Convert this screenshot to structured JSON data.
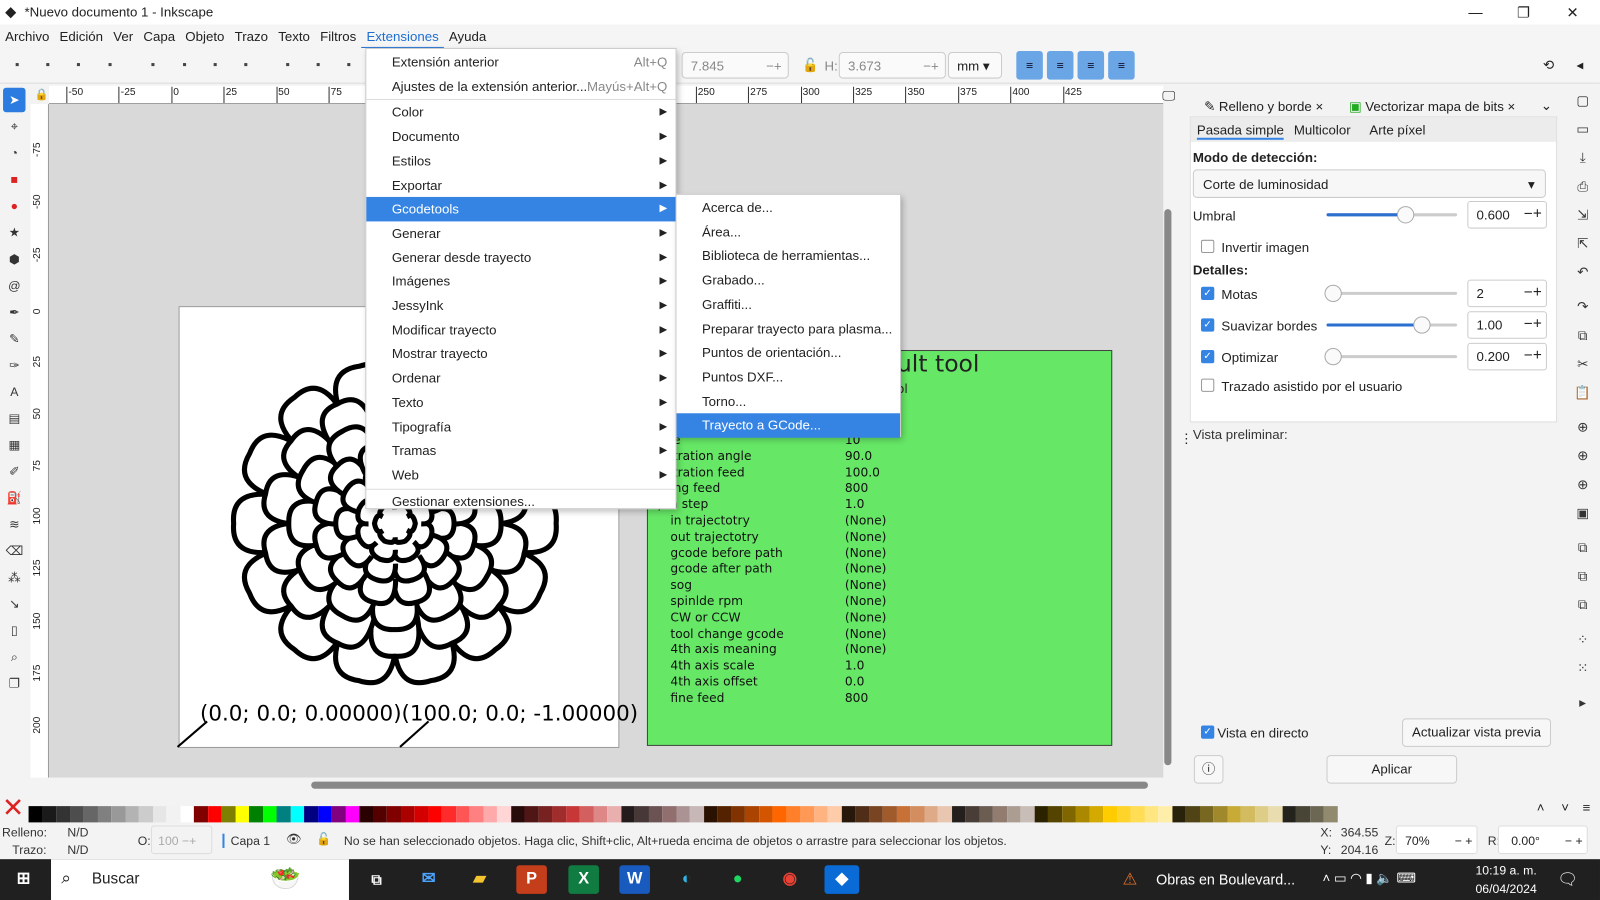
{
  "window": {
    "title": "*Nuevo documento 1 - Inkscape",
    "minimize": "—",
    "maximize": "❐",
    "close": "✕"
  },
  "menubar": [
    "Archivo",
    "Edición",
    "Ver",
    "Capa",
    "Objeto",
    "Trazo",
    "Texto",
    "Filtros",
    "Extensiones",
    "Ayuda"
  ],
  "toolbar": {
    "w_value": "7.845",
    "h_label": "H:",
    "h_value": "3.673",
    "unit": "mm"
  },
  "ruler_top": [
    "-50",
    "-25",
    "0",
    "25",
    "50",
    "75",
    "100",
    "125",
    "150",
    "175",
    "200",
    "225",
    "250",
    "275",
    "300",
    "325",
    "350",
    "375",
    "400",
    "425"
  ],
  "ruler_left": [
    "-75",
    "-50",
    "-25",
    "0",
    "25",
    "50",
    "75",
    "100",
    "125",
    "150",
    "175",
    "200"
  ],
  "extensions_menu": {
    "items": [
      {
        "label": "Extensión anterior",
        "shortcut": "Alt+Q"
      },
      {
        "label": "Ajustes de la extensión anterior...",
        "shortcut": "Mayús+Alt+Q"
      },
      {
        "label": "Color",
        "sub": true
      },
      {
        "label": "Documento",
        "sub": true
      },
      {
        "label": "Estilos",
        "sub": true
      },
      {
        "label": "Exportar",
        "sub": true
      },
      {
        "label": "Gcodetools",
        "sub": true,
        "highlight": true
      },
      {
        "label": "Generar",
        "sub": true
      },
      {
        "label": "Generar desde trayecto",
        "sub": true
      },
      {
        "label": "Imágenes",
        "sub": true
      },
      {
        "label": "JessyInk",
        "sub": true
      },
      {
        "label": "Modificar trayecto",
        "sub": true
      },
      {
        "label": "Mostrar trayecto",
        "sub": true
      },
      {
        "label": "Ordenar",
        "sub": true
      },
      {
        "label": "Texto",
        "sub": true
      },
      {
        "label": "Tipografía",
        "sub": true
      },
      {
        "label": "Tramas",
        "sub": true
      },
      {
        "label": "Web",
        "sub": true
      },
      {
        "label": "Gestionar extensiones..."
      }
    ]
  },
  "gcodetools_submenu": [
    "Acerca de...",
    "Área...",
    "Biblioteca de herramientas...",
    "Grabado...",
    "Graffiti...",
    "Preparar trayecto para plasma...",
    "Puntos de orientación...",
    "Puntos DXF...",
    "Torno...",
    "Trayecto a GCode..."
  ],
  "canvas": {
    "coords_text": "(0.0; 0.0; 0.00000)(100.0; 0.0; -1.00000)",
    "tool_title": "ult tool",
    "tool_sub": "ol",
    "params": [
      [
        "hape",
        "10"
      ],
      [
        "enetration angle",
        "90.0"
      ],
      [
        "enetration feed",
        "100.0"
      ],
      [
        "assing feed",
        "800"
      ],
      [
        "epth step",
        "1.0"
      ],
      [
        "in trajectotry",
        "(None)"
      ],
      [
        "out trajectotry",
        "(None)"
      ],
      [
        "gcode before path",
        "(None)"
      ],
      [
        "gcode after path",
        "(None)"
      ],
      [
        "sog",
        "(None)"
      ],
      [
        "spinlde rpm",
        "(None)"
      ],
      [
        "CW or CCW",
        "(None)"
      ],
      [
        "tool change gcode",
        "(None)"
      ],
      [
        "4th axis meaning",
        "(None)"
      ],
      [
        "4th axis scale",
        "1.0"
      ],
      [
        "4th axis offset",
        "0.0"
      ],
      [
        "fine feed",
        "800"
      ]
    ],
    "green": "#66e766"
  },
  "panel": {
    "tabs": [
      {
        "label": "Relleno y borde"
      },
      {
        "label": "Vectorizar mapa de bits",
        "active": true
      }
    ],
    "subtabs": [
      "Pasada simple",
      "Multicolor",
      "Arte píxel"
    ],
    "mode_label": "Modo de detección:",
    "mode_value": "Corte de luminosidad",
    "threshold_label": "Umbral",
    "threshold_value": "0.600",
    "threshold_fraction": 0.6,
    "invert_label": "Invertir imagen",
    "details_label": "Detalles:",
    "speckles_label": "Motas",
    "speckles_value": "2",
    "smooth_label": "Suavizar bordes",
    "smooth_value": "1.00",
    "smooth_fraction": 0.73,
    "optimize_label": "Optimizar",
    "optimize_value": "0.200",
    "assisted_label": "Trazado asistido por el usuario",
    "preview_label": "Vista preliminar:",
    "live_label": "Vista en directo",
    "update_button": "Actualizar vista previa",
    "apply_button": "Aplicar"
  },
  "palette": [
    "#000000",
    "#1a1a1a",
    "#333333",
    "#4d4d4d",
    "#666666",
    "#808080",
    "#999999",
    "#b3b3b3",
    "#cccccc",
    "#e6e6e6",
    "#f2f2f2",
    "#ffffff",
    "#800000",
    "#ff0000",
    "#808000",
    "#ffff00",
    "#008000",
    "#00ff00",
    "#008080",
    "#00ffff",
    "#000080",
    "#0000ff",
    "#800080",
    "#ff00ff",
    "#2b0000",
    "#550000",
    "#800000",
    "#aa0000",
    "#d40000",
    "#ff0000",
    "#ff2a2a",
    "#ff5555",
    "#ff8080",
    "#ffaaaa",
    "#ffd5d5",
    "#280b0b",
    "#501616",
    "#782121",
    "#a02c2c",
    "#c83737",
    "#d35f5f",
    "#de8787",
    "#e9afaf",
    "#241c1c",
    "#483737",
    "#6c5353",
    "#916f6f",
    "#ac9393",
    "#c8b7b7",
    "#2b1100",
    "#552200",
    "#803300",
    "#aa4400",
    "#d45500",
    "#ff6600",
    "#ff7f2a",
    "#ff9955",
    "#ffb380",
    "#ffccaa",
    "#28170b",
    "#502d16",
    "#784421",
    "#a05a2c",
    "#c87137",
    "#d38d5f",
    "#deaa87",
    "#e9c6af",
    "#241f1c",
    "#483e37",
    "#6c5d53",
    "#917c6f",
    "#ac9d93",
    "#c8beb7",
    "#2b2200",
    "#554400",
    "#806600",
    "#aa8800",
    "#d4aa00",
    "#ffcc00",
    "#ffd42a",
    "#ffdd55",
    "#ffe680",
    "#ffeeaa",
    "#28220b",
    "#504416",
    "#786721",
    "#a0892c",
    "#c8ab37",
    "#d3bc5f",
    "#decd87",
    "#e9ddaf",
    "#24221c",
    "#484537",
    "#6c6753",
    "#918a6f"
  ],
  "status": {
    "fill_label": "Relleno:",
    "fill_value": "N/D",
    "stroke_label": "Trazo:",
    "stroke_value": "N/D",
    "opacity_label": "O:",
    "opacity_value": "100",
    "layer": "Capa 1",
    "message": "No se han seleccionado objetos. Haga clic, Shift+clic, Alt+rueda encima de objetos o arrastre para seleccionar los objetos.",
    "x_label": "X:",
    "x_value": "364.55",
    "y_label": "Y:",
    "y_value": "204.16",
    "zoom_label": "Z:",
    "zoom_value": "70%",
    "rot_label": "R:",
    "rot_value": "0.00°"
  },
  "taskbar": {
    "search": "Buscar",
    "news": "Obras en Boulevard...",
    "time": "10:19 a. m.",
    "date": "06/04/2024"
  }
}
